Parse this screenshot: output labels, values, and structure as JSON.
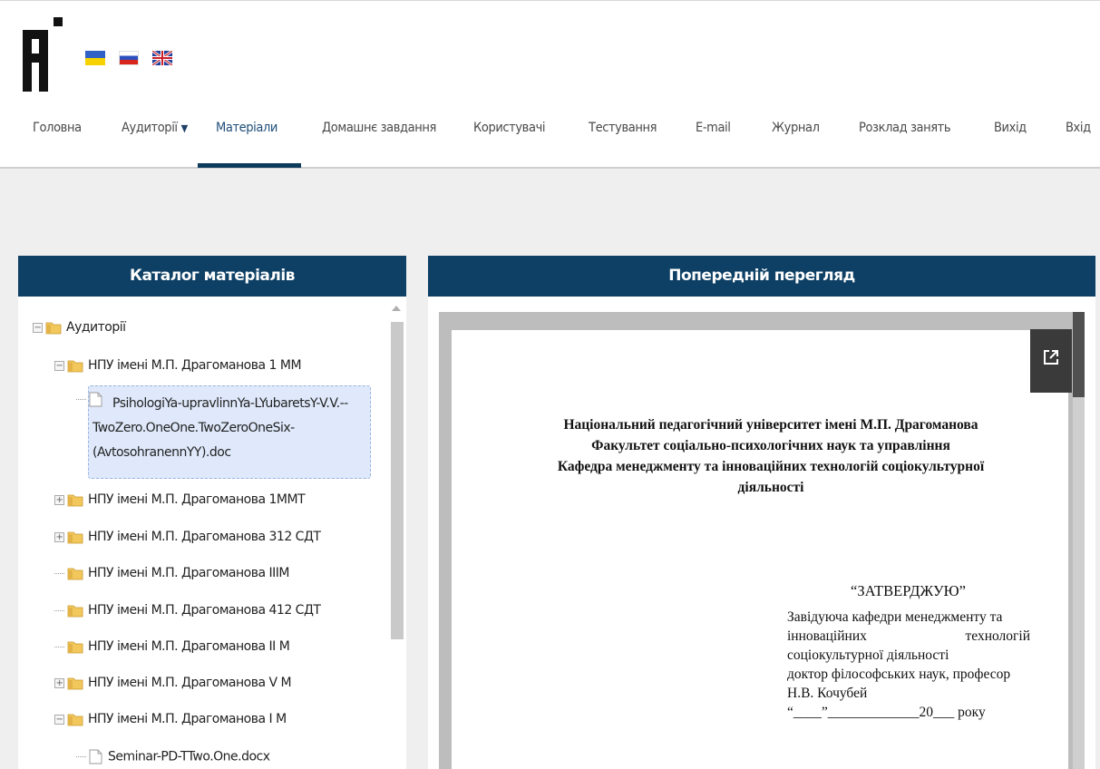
{
  "header": {
    "flags": [
      "ukrainian-flag",
      "russian-flag",
      "uk-flag"
    ]
  },
  "nav": {
    "items": [
      {
        "label": "Головна"
      },
      {
        "label": "Аудиторії",
        "caret": "▼"
      },
      {
        "label": "Матеріали",
        "active": true
      },
      {
        "label": "Домашнє завдання"
      },
      {
        "label": "Користувачі"
      },
      {
        "label": "Тестування"
      },
      {
        "label": "E-mail"
      },
      {
        "label": "Журнал"
      },
      {
        "label": "Розклад занять"
      },
      {
        "label": "Вихід"
      },
      {
        "label": "Вхід"
      }
    ]
  },
  "catalog": {
    "title": "Каталог матеріалів",
    "tree": [
      {
        "label": "Аудиторії"
      },
      {
        "label": "НПУ імені М.П. Драгоманова 1 ММ"
      },
      {
        "label": "PsihologiYa-upravlinnYa-LYubaretsY-V.V.--TwoZero.OneOne.TwoZeroOneSix-(AvtosohranennYY).doc"
      },
      {
        "label": "НПУ імені М.П. Драгоманова 1ММТ"
      },
      {
        "label": "НПУ імені М.П. Драгоманова 312 СДТ"
      },
      {
        "label": "НПУ імені М.П. Драгоманова IIIМ"
      },
      {
        "label": "НПУ імені М.П. Драгоманова 412 СДТ"
      },
      {
        "label": "НПУ імені М.П. Драгоманова II М"
      },
      {
        "label": "НПУ імені М.П. Драгоманова V М"
      },
      {
        "label": "НПУ імені М.П. Драгоманова I М"
      },
      {
        "label": "Seminar-PD-TTwo.One.docx"
      }
    ],
    "selected_lines": [
      "PsihologiYa-upravlinnYa-LYubaretsY-V.V.--",
      "TwoZero.OneOne.TwoZeroOneSix-",
      "(AvtosohranennYY).doc"
    ]
  },
  "preview": {
    "title": "Попередній перегляд",
    "doc": {
      "heading_lines": [
        "Національний педагогічний університет імені М.П. Драгоманова",
        "Факультет соціально-психологічних наук та управління",
        "Кафедра менеджменту та інноваційних технологій соціокультурної",
        "діяльності"
      ],
      "approve_title": "“ЗАТВЕРДЖУЮ”",
      "approve_lines": [
        "Завідуюча кафедри менеджменту та",
        "інноваційних технологій",
        "соціокультурної діяльності",
        "доктор філософських наук, професор",
        "Н.В.  Кочубей",
        "“____”_____________20___ року"
      ]
    }
  },
  "colors": {
    "panel_header": "#0e4065",
    "nav_active_underline": "#0e3a5c",
    "selection": "#dfe9fb"
  }
}
